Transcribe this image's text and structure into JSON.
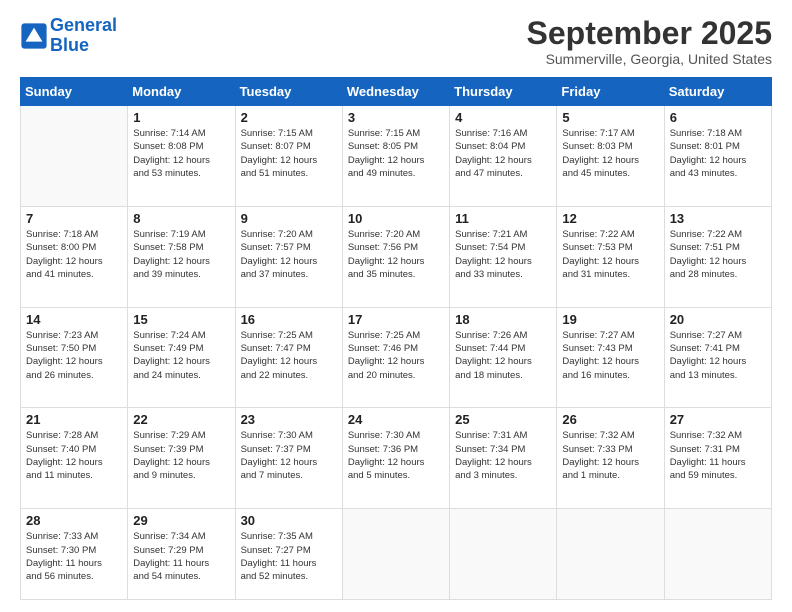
{
  "logo": {
    "line1": "General",
    "line2": "Blue"
  },
  "header": {
    "title": "September 2025",
    "location": "Summerville, Georgia, United States"
  },
  "weekdays": [
    "Sunday",
    "Monday",
    "Tuesday",
    "Wednesday",
    "Thursday",
    "Friday",
    "Saturday"
  ],
  "weeks": [
    [
      {
        "day": "",
        "info": ""
      },
      {
        "day": "1",
        "info": "Sunrise: 7:14 AM\nSunset: 8:08 PM\nDaylight: 12 hours\nand 53 minutes."
      },
      {
        "day": "2",
        "info": "Sunrise: 7:15 AM\nSunset: 8:07 PM\nDaylight: 12 hours\nand 51 minutes."
      },
      {
        "day": "3",
        "info": "Sunrise: 7:15 AM\nSunset: 8:05 PM\nDaylight: 12 hours\nand 49 minutes."
      },
      {
        "day": "4",
        "info": "Sunrise: 7:16 AM\nSunset: 8:04 PM\nDaylight: 12 hours\nand 47 minutes."
      },
      {
        "day": "5",
        "info": "Sunrise: 7:17 AM\nSunset: 8:03 PM\nDaylight: 12 hours\nand 45 minutes."
      },
      {
        "day": "6",
        "info": "Sunrise: 7:18 AM\nSunset: 8:01 PM\nDaylight: 12 hours\nand 43 minutes."
      }
    ],
    [
      {
        "day": "7",
        "info": "Sunrise: 7:18 AM\nSunset: 8:00 PM\nDaylight: 12 hours\nand 41 minutes."
      },
      {
        "day": "8",
        "info": "Sunrise: 7:19 AM\nSunset: 7:58 PM\nDaylight: 12 hours\nand 39 minutes."
      },
      {
        "day": "9",
        "info": "Sunrise: 7:20 AM\nSunset: 7:57 PM\nDaylight: 12 hours\nand 37 minutes."
      },
      {
        "day": "10",
        "info": "Sunrise: 7:20 AM\nSunset: 7:56 PM\nDaylight: 12 hours\nand 35 minutes."
      },
      {
        "day": "11",
        "info": "Sunrise: 7:21 AM\nSunset: 7:54 PM\nDaylight: 12 hours\nand 33 minutes."
      },
      {
        "day": "12",
        "info": "Sunrise: 7:22 AM\nSunset: 7:53 PM\nDaylight: 12 hours\nand 31 minutes."
      },
      {
        "day": "13",
        "info": "Sunrise: 7:22 AM\nSunset: 7:51 PM\nDaylight: 12 hours\nand 28 minutes."
      }
    ],
    [
      {
        "day": "14",
        "info": "Sunrise: 7:23 AM\nSunset: 7:50 PM\nDaylight: 12 hours\nand 26 minutes."
      },
      {
        "day": "15",
        "info": "Sunrise: 7:24 AM\nSunset: 7:49 PM\nDaylight: 12 hours\nand 24 minutes."
      },
      {
        "day": "16",
        "info": "Sunrise: 7:25 AM\nSunset: 7:47 PM\nDaylight: 12 hours\nand 22 minutes."
      },
      {
        "day": "17",
        "info": "Sunrise: 7:25 AM\nSunset: 7:46 PM\nDaylight: 12 hours\nand 20 minutes."
      },
      {
        "day": "18",
        "info": "Sunrise: 7:26 AM\nSunset: 7:44 PM\nDaylight: 12 hours\nand 18 minutes."
      },
      {
        "day": "19",
        "info": "Sunrise: 7:27 AM\nSunset: 7:43 PM\nDaylight: 12 hours\nand 16 minutes."
      },
      {
        "day": "20",
        "info": "Sunrise: 7:27 AM\nSunset: 7:41 PM\nDaylight: 12 hours\nand 13 minutes."
      }
    ],
    [
      {
        "day": "21",
        "info": "Sunrise: 7:28 AM\nSunset: 7:40 PM\nDaylight: 12 hours\nand 11 minutes."
      },
      {
        "day": "22",
        "info": "Sunrise: 7:29 AM\nSunset: 7:39 PM\nDaylight: 12 hours\nand 9 minutes."
      },
      {
        "day": "23",
        "info": "Sunrise: 7:30 AM\nSunset: 7:37 PM\nDaylight: 12 hours\nand 7 minutes."
      },
      {
        "day": "24",
        "info": "Sunrise: 7:30 AM\nSunset: 7:36 PM\nDaylight: 12 hours\nand 5 minutes."
      },
      {
        "day": "25",
        "info": "Sunrise: 7:31 AM\nSunset: 7:34 PM\nDaylight: 12 hours\nand 3 minutes."
      },
      {
        "day": "26",
        "info": "Sunrise: 7:32 AM\nSunset: 7:33 PM\nDaylight: 12 hours\nand 1 minute."
      },
      {
        "day": "27",
        "info": "Sunrise: 7:32 AM\nSunset: 7:31 PM\nDaylight: 11 hours\nand 59 minutes."
      }
    ],
    [
      {
        "day": "28",
        "info": "Sunrise: 7:33 AM\nSunset: 7:30 PM\nDaylight: 11 hours\nand 56 minutes."
      },
      {
        "day": "29",
        "info": "Sunrise: 7:34 AM\nSunset: 7:29 PM\nDaylight: 11 hours\nand 54 minutes."
      },
      {
        "day": "30",
        "info": "Sunrise: 7:35 AM\nSunset: 7:27 PM\nDaylight: 11 hours\nand 52 minutes."
      },
      {
        "day": "",
        "info": ""
      },
      {
        "day": "",
        "info": ""
      },
      {
        "day": "",
        "info": ""
      },
      {
        "day": "",
        "info": ""
      }
    ]
  ]
}
